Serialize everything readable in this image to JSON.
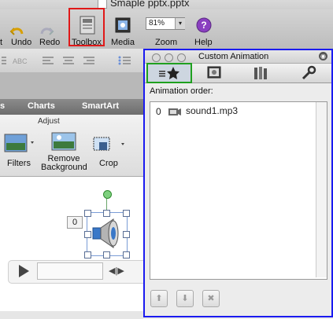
{
  "window": {
    "title": "Smaple pptx.pptx"
  },
  "toolbar": {
    "undo_label": "Undo",
    "redo_label": "Redo",
    "toolbox_label": "Toolbox",
    "media_label": "Media",
    "zoom_label": "Zoom",
    "zoom_value": "81%",
    "help_label": "Help",
    "left_partial_label": "t"
  },
  "ribbon": {
    "tabs": [
      "s",
      "Charts",
      "SmartArt"
    ],
    "group_label": "Adjust",
    "buttons": [
      {
        "label": "Filters"
      },
      {
        "label": "Remove\nBackground"
      },
      {
        "label": "Crop"
      }
    ]
  },
  "slide": {
    "animation_badge": "0"
  },
  "panel": {
    "title": "Custom Animation",
    "animation_order_label": "Animation order:",
    "items": [
      {
        "order": "0",
        "name": "sound1.mp3"
      }
    ],
    "tabs": [
      "effects-icon",
      "media-icon",
      "library-icon",
      "wrench-icon"
    ]
  },
  "colors": {
    "highlight_toolbox": "#e01818",
    "highlight_panel": "#1a1af0",
    "highlight_tab": "#1fa01f"
  }
}
